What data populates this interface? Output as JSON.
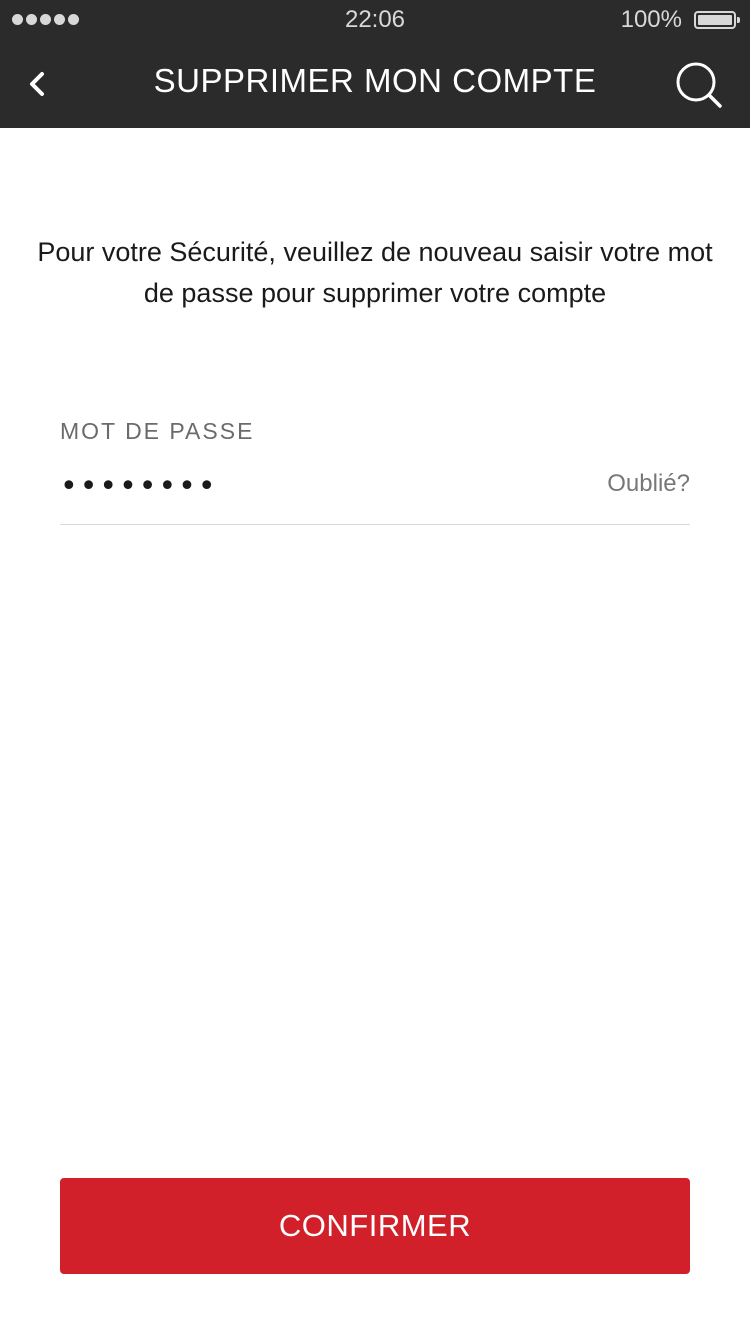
{
  "status_bar": {
    "time": "22:06",
    "battery_percent": "100%",
    "battery_level": 1.0,
    "signal_bars": 5
  },
  "nav": {
    "title": "SUPPRIMER MON COMPTE",
    "back_icon": "chevron-left-icon",
    "search_icon": "search-icon"
  },
  "main": {
    "intro_text": "Pour votre Sécurité, veuillez de nouveau saisir votre mot de passe pour supprimer votre compte",
    "password_label": "MOT DE PASSE",
    "password_value": "••••••••",
    "forgot_link": "Oublié?",
    "confirm_label": "CONFIRMER"
  },
  "colors": {
    "header_bg": "#2b2b2b",
    "accent": "#d12029",
    "text": "#1a1a1a",
    "muted": "#6b6b6b"
  }
}
